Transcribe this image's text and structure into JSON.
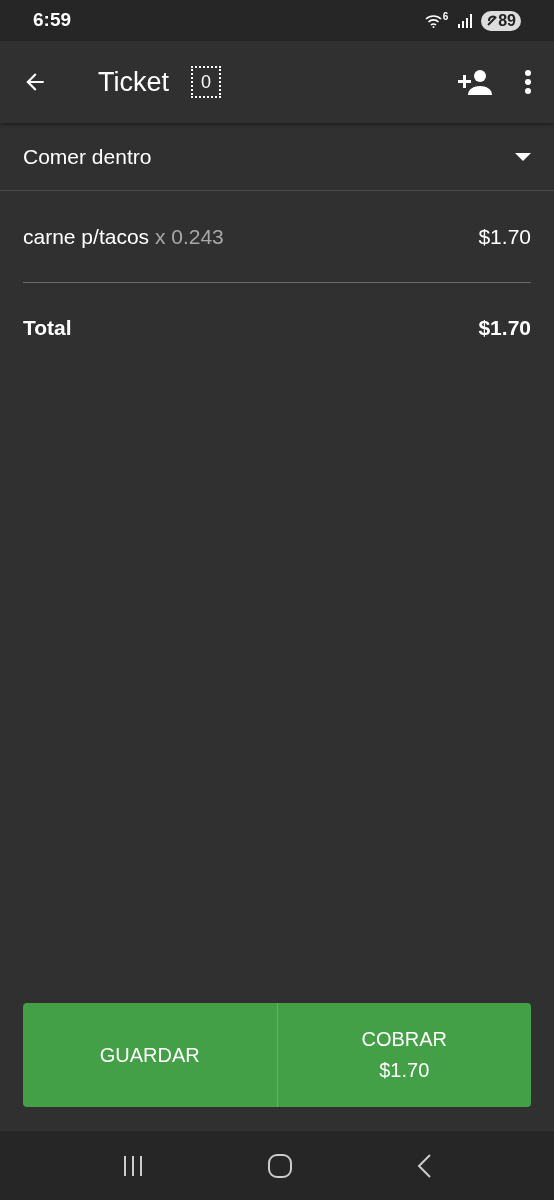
{
  "status_bar": {
    "time": "6:59",
    "wifi_label": "6",
    "battery": "89"
  },
  "app_bar": {
    "title": "Ticket",
    "ticket_count": "0"
  },
  "dining_option": {
    "value": "Comer dentro"
  },
  "items": [
    {
      "name": "carne p/tacos",
      "quantity": "x 0.243",
      "price": "$1.70"
    }
  ],
  "total": {
    "label": "Total",
    "amount": "$1.70"
  },
  "buttons": {
    "save": "GUARDAR",
    "charge": "COBRAR",
    "charge_amount": "$1.70"
  }
}
